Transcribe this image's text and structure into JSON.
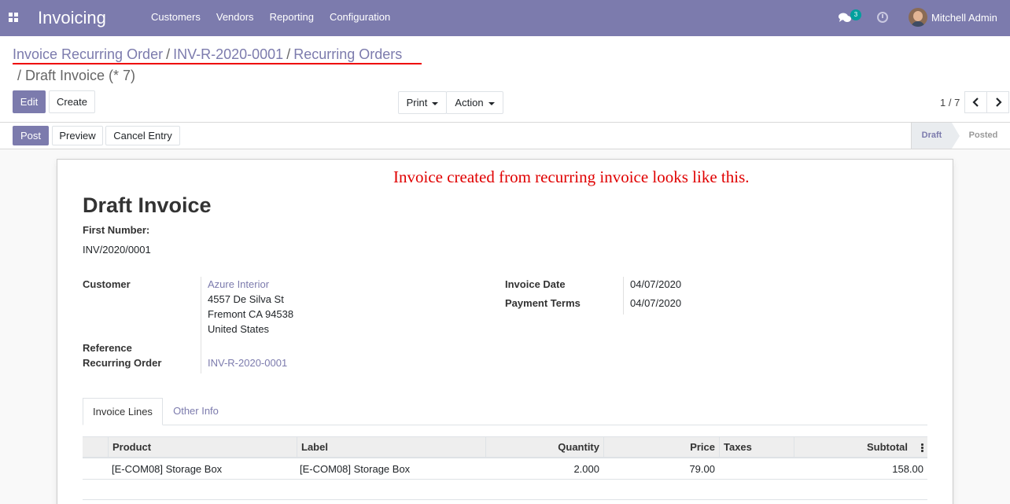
{
  "navbar": {
    "app_title": "Invoicing",
    "menu": [
      "Customers",
      "Vendors",
      "Reporting",
      "Configuration"
    ],
    "chat_count": "3",
    "user_name": "Mitchell Admin"
  },
  "breadcrumb": {
    "items": [
      "Invoice Recurring Order",
      "INV-R-2020-0001",
      "Recurring Orders"
    ],
    "separator": "/",
    "current": "/ Draft Invoice (* 7)"
  },
  "toolbar": {
    "edit": "Edit",
    "create": "Create",
    "print": "Print",
    "action": "Action",
    "pager": "1 / 7"
  },
  "statusbar": {
    "post": "Post",
    "preview": "Preview",
    "cancel_entry": "Cancel Entry",
    "stages": [
      "Draft",
      "Posted"
    ],
    "active_stage": "Draft"
  },
  "annotation": "Invoice created from recurring invoice looks like this.",
  "form": {
    "title": "Draft Invoice",
    "first_number_label": "First Number:",
    "first_number": "INV/2020/0001",
    "customer_label": "Customer",
    "customer_name": "Azure Interior",
    "address": [
      "4557 De Silva St",
      "Fremont CA 94538",
      "United States"
    ],
    "reference_label": "Reference",
    "recurring_order_label": "Recurring Order",
    "recurring_order": "INV-R-2020-0001",
    "invoice_date_label": "Invoice Date",
    "invoice_date": "04/07/2020",
    "payment_terms_label": "Payment Terms",
    "payment_terms": "04/07/2020"
  },
  "tabs": [
    "Invoice Lines",
    "Other Info"
  ],
  "table": {
    "headers": [
      "Product",
      "Label",
      "Quantity",
      "Price",
      "Taxes",
      "Subtotal"
    ],
    "rows": [
      [
        "[E-COM08] Storage Box",
        "[E-COM08] Storage Box",
        "2.000",
        "79.00",
        "",
        "158.00"
      ]
    ]
  },
  "colors": {
    "brand": "#7c7bad",
    "annotation_red": "#e00000",
    "badge": "#00a09d"
  }
}
